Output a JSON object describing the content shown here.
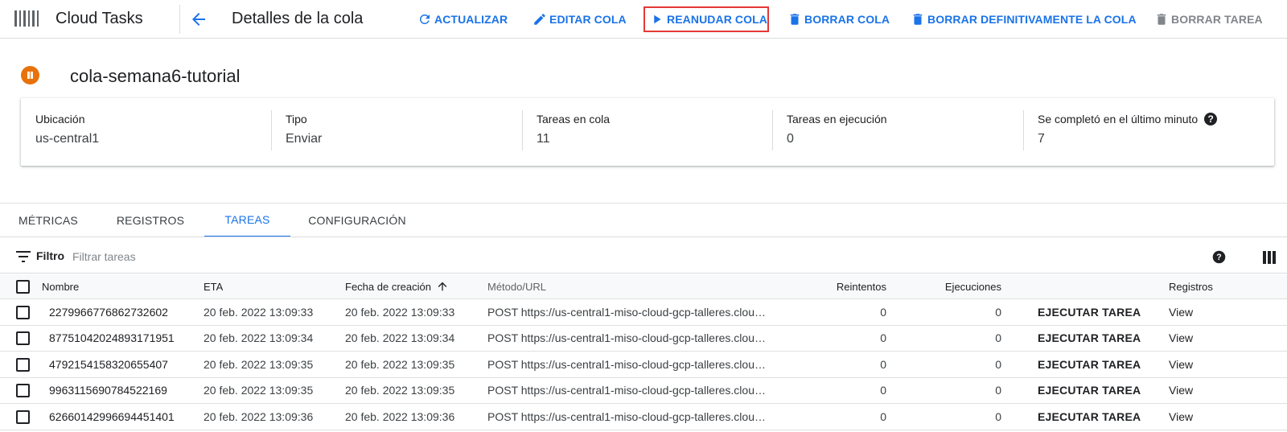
{
  "app": {
    "product_name": "Cloud Tasks",
    "page_title": "Detalles de la cola"
  },
  "toolbar": {
    "refresh_label": "ACTUALIZAR",
    "edit_label": "EDITAR COLA",
    "resume_label": "REANUDAR COLA",
    "delete_label": "BORRAR COLA",
    "purge_label": "BORRAR DEFINITIVAMENTE LA COLA",
    "delete_task_label": "BORRAR TAREA"
  },
  "queue": {
    "name": "cola-semana6-tutorial",
    "status": "paused",
    "status_color": "#e8710a",
    "stats": [
      {
        "label": "Ubicación",
        "value": "us-central1"
      },
      {
        "label": "Tipo",
        "value": "Enviar"
      },
      {
        "label": "Tareas en cola",
        "value": "11"
      },
      {
        "label": "Tareas en ejecución",
        "value": "0"
      },
      {
        "label": "Se completó en el último minuto",
        "value": "7"
      }
    ]
  },
  "tabs": [
    {
      "label": "MÉTRICAS"
    },
    {
      "label": "REGISTROS"
    },
    {
      "label": "TAREAS",
      "active": true
    },
    {
      "label": "CONFIGURACIÓN"
    }
  ],
  "filter": {
    "label": "Filtro",
    "placeholder": "Filtrar tareas"
  },
  "table": {
    "headers": {
      "name": "Nombre",
      "eta": "ETA",
      "created": "Fecha de creación",
      "method": "Método/URL",
      "retries": "Reintentos",
      "executions": "Ejecuciones",
      "logs": "Registros"
    },
    "rows": [
      {
        "name": "2279966776862732602",
        "eta": "20 feb. 2022 13:09:33",
        "created": "20 feb. 2022 13:09:33",
        "method": "POST https://us-central1-miso-cloud-gcp-talleres.clou…",
        "retries": "0",
        "executions": "0",
        "action": "EJECUTAR TAREA",
        "logs": "View"
      },
      {
        "name": "87751042024893171951",
        "eta": "20 feb. 2022 13:09:34",
        "created": "20 feb. 2022 13:09:34",
        "method": "POST https://us-central1-miso-cloud-gcp-talleres.clou…",
        "retries": "0",
        "executions": "0",
        "action": "EJECUTAR TAREA",
        "logs": "View"
      },
      {
        "name": "4792154158320655407",
        "eta": "20 feb. 2022 13:09:35",
        "created": "20 feb. 2022 13:09:35",
        "method": "POST https://us-central1-miso-cloud-gcp-talleres.clou…",
        "retries": "0",
        "executions": "0",
        "action": "EJECUTAR TAREA",
        "logs": "View"
      },
      {
        "name": "9963115690784522169",
        "eta": "20 feb. 2022 13:09:35",
        "created": "20 feb. 2022 13:09:35",
        "method": "POST https://us-central1-miso-cloud-gcp-talleres.clou…",
        "retries": "0",
        "executions": "0",
        "action": "EJECUTAR TAREA",
        "logs": "View"
      },
      {
        "name": "62660142996694451401",
        "eta": "20 feb. 2022 13:09:36",
        "created": "20 feb. 2022 13:09:36",
        "method": "POST https://us-central1-miso-cloud-gcp-talleres.clou…",
        "retries": "0",
        "executions": "0",
        "action": "EJECUTAR TAREA",
        "logs": "View"
      }
    ]
  },
  "colors": {
    "accent": "#1a73e8",
    "highlight_border": "#e53935"
  }
}
